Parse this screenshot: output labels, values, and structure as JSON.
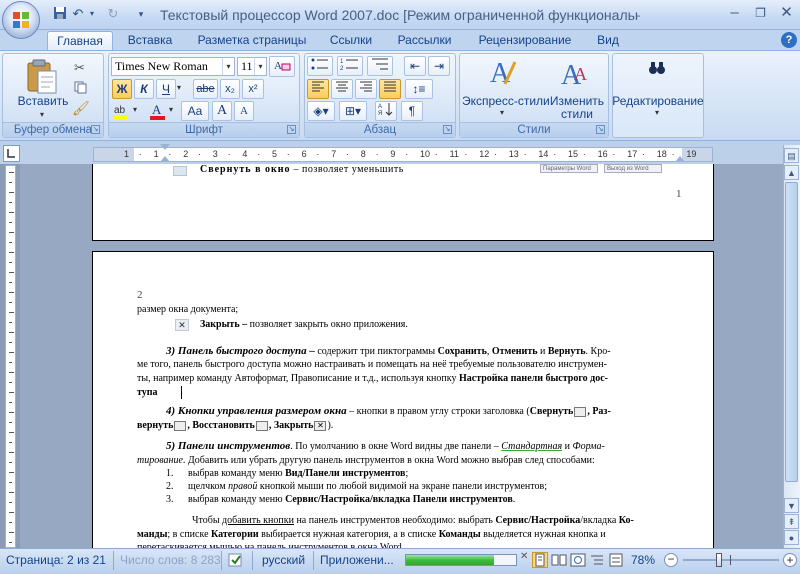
{
  "window": {
    "title": "Текстовый процессор Word 2007.doc [Режим ограниченной функциональности] - Micros",
    "minimize": "–",
    "maximize": "❐",
    "close": "✕"
  },
  "tabs": [
    {
      "label": "Главная",
      "active": true
    },
    {
      "label": "Вставка"
    },
    {
      "label": "Разметка страницы"
    },
    {
      "label": "Ссылки"
    },
    {
      "label": "Рассылки"
    },
    {
      "label": "Рецензирование"
    },
    {
      "label": "Вид"
    }
  ],
  "ribbon": {
    "clipboard": {
      "caption": "Буфер обмена",
      "paste_label": "Вставить"
    },
    "font": {
      "caption": "Шрифт",
      "font_name": "Times New Roman",
      "font_size": "11",
      "bold": "Ж",
      "italic": "К",
      "underline": "Ч",
      "strike": "abe",
      "subscript": "x₂",
      "superscript": "x²",
      "change_case": "Aa",
      "grow": "A",
      "shrink": "A"
    },
    "paragraph": {
      "caption": "Абзац",
      "pilcrow": "¶"
    },
    "styles": {
      "caption": "Стили",
      "express_label": "Экспресс-стили",
      "change_label_1": "Изменить",
      "change_label_2": "стили"
    },
    "editing": {
      "label": "Редактирование"
    }
  },
  "ruler": {
    "numbers": [
      "1",
      "·",
      "1",
      "·",
      "2",
      "·",
      "3",
      "·",
      "4",
      "·",
      "5",
      "·",
      "6",
      "·",
      "7",
      "·",
      "8",
      "·",
      "9",
      "·",
      "10",
      "·",
      "11",
      "·",
      "12",
      "·",
      "13",
      "·",
      "14",
      "·",
      "15",
      "·",
      "16",
      "·",
      "17",
      "·",
      "18",
      "·",
      "19"
    ]
  },
  "page1": {
    "top_line_bold": "Свернуть в окно",
    "top_line_rest": " – позволяет уменьшить",
    "mini1": "Параметры Word",
    "mini2": "Выход из Word",
    "page_number": "1"
  },
  "page2": {
    "page_number": "2",
    "l1": "размер окна документа;",
    "close_bold": "Закрыть –",
    "close_rest": " позволяет закрыть  окно приложения.",
    "p3_heading": "3) Панель быстрого доступа –",
    "p3_a": " содержит три пиктограммы ",
    "p3_save": "Сохранить",
    "p3_b": ", ",
    "p3_undo": "Отменить",
    "p3_c": " и ",
    "p3_redo": "Вернуть",
    "p3_d": ". Кро-",
    "p3_l2": "ме того, панель быстрого доступа можно настраивать и помещать на неё требуемые пользователю инструмен-",
    "p3_l3a": "ты, например команду Автоформат, Правописание и т.д., используя кнопку ",
    "p3_l3b": "Настройка панели быстрого дос-",
    "p3_l4": "тупа",
    "p4_heading": "4) Кнопки управления размером окна",
    "p4_a": " – кнопки в правом углу строки заголовка (",
    "p4_min": "Свернуть",
    "p4_b": ", Раз-",
    "p4_l2a": "вернуть",
    "p4_restore": ", Восстановить",
    "p4_close": ", Закрыть",
    "p4_end": ").",
    "p5_heading": "5) Панели инструментов",
    "p5_a": ". По умолчанию в окне Word видны две панели – ",
    "p5_std": "Стандартная",
    "p5_b": " и ",
    "p5_fmt": "Форма-",
    "p5_l2a": "тирование",
    "p5_l2b": ".  Добавить или убрать другую панель инструментов в окна Word можно выбрав след способами:",
    "list": [
      {
        "num": "1.",
        "a": "выбрав команду меню ",
        "b": "Вид/Панели инструментов",
        "c": ";"
      },
      {
        "num": "2.",
        "a": "щелчком ",
        "i": "правой",
        "c": " кнопкой мыши по любой видимой на экране панели инструментов;"
      },
      {
        "num": "3.",
        "a": "выбрав команду меню ",
        "b": "Сервис/Настройка/вкладка  Панели  инструментов",
        "c": "."
      }
    ],
    "p6_a": "Чтобы ",
    "p6_u": "добавить кнопки",
    "p6_b": " на панель инструментов необходимо: выбрать ",
    "p6_c": "Сервис/Настройка",
    "p6_d": "/вкладка ",
    "p6_e": "Ко-",
    "p6_l2a": "манды",
    "p6_l2b": "; в списке ",
    "p6_l2c": "Категории",
    "p6_l2d": " выбирается нужная категория, а в списке ",
    "p6_l2e": "Команды",
    "p6_l2f": " выделяется нужная кнопка и",
    "p6_l3": "перетаскивается мышью на панель инструментов в окна Word"
  },
  "status": {
    "page": "Страница: 2 из 21",
    "words": "Число слов: 8 283",
    "lang": "русский",
    "app": "Приложени...",
    "progress": 0.8,
    "zoom": "78%"
  },
  "colors": {
    "accent": "#15428b",
    "ribbon": "#d7e5f7",
    "progress": "#3fbd3f"
  }
}
